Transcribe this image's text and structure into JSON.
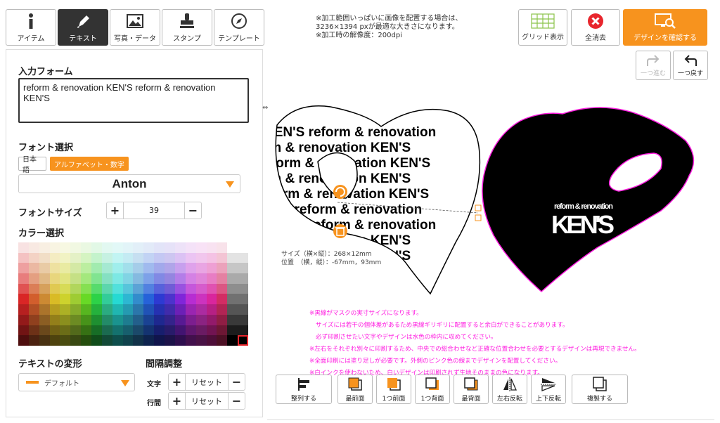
{
  "tabs": [
    {
      "label": "アイテム",
      "icon": "info-icon",
      "active": false
    },
    {
      "label": "テキスト",
      "icon": "pen-icon",
      "active": true
    },
    {
      "label": "写真・データ",
      "icon": "image-icon",
      "active": false
    },
    {
      "label": "スタンプ",
      "icon": "stamp-icon",
      "active": false
    },
    {
      "label": "テンプレート",
      "icon": "compass-icon",
      "active": false
    }
  ],
  "notice": [
    "※加工範囲いっぱいに画像を配置する場合は、",
    "3236×1394 pxが最適な大きさになります。",
    "※加工時の解像度：200dpi"
  ],
  "top_buttons": {
    "grid": "グリッド表示",
    "clear": "全消去",
    "confirm": "デザインを確認する"
  },
  "history": {
    "redo": "一つ進む",
    "undo": "一つ戻す"
  },
  "panel": {
    "input_label": "入力フォーム",
    "input_value": "reform & renovation KEN'S reform & renovation KEN'S",
    "font_label": "フォント選択",
    "font_tab_ja": "日本語",
    "font_tab_alpha": "アルファベット・数字",
    "font_value": "Anton",
    "size_label": "フォントサイズ",
    "size_value": "39",
    "color_label": "カラー選択",
    "transform_label": "テキストの変形",
    "transform_value": "デフォルト",
    "spacing_label": "間隔調整",
    "spacing_char": "文字",
    "spacing_line": "行間",
    "reset": "リセット"
  },
  "canvas": {
    "pattern_line1": "reform & renovation KEN'S",
    "pattern_line2": "KEN'S reform & renovation",
    "logo_small": "reform & renovation",
    "logo_big": "KEN'S",
    "size_info": "サイズ（横×縦）：268×12mm",
    "pos_info": "位置　（横，縦）：-67mm，93mm",
    "arrow": "⇔"
  },
  "notes": [
    "※黒線がマスクの実寸サイズになります。",
    "サイズには若干の個体差があるため黒線ギリギリに配置すると余白ができることがあります。",
    "必ず印刷させたい文字やデザインは水色の枠内に収めてください。",
    "※左右をそれぞれ別々に印刷するため、中央での総合わせなど正確な位置合わせを必要とするデザインは再現できません。",
    "※全面印刷には塗り足しが必要です。外側のピンク色の線までデザインを配置してください。",
    "※白インクを使わないため、白いデザインは印刷されず生地そのままの色になります。"
  ],
  "tools": {
    "align": "整列する",
    "front_most": "最前面",
    "front": "1つ前面",
    "back": "1つ背面",
    "back_most": "最背面",
    "flip_h": "左右反転",
    "flip_v": "上下反転",
    "duplicate": "複製する"
  },
  "colors": {
    "accent": "#f7931e",
    "mask_pink": "#ff1ce0",
    "clear_red": "#e8262d",
    "grid_green": "#8bc34a"
  }
}
